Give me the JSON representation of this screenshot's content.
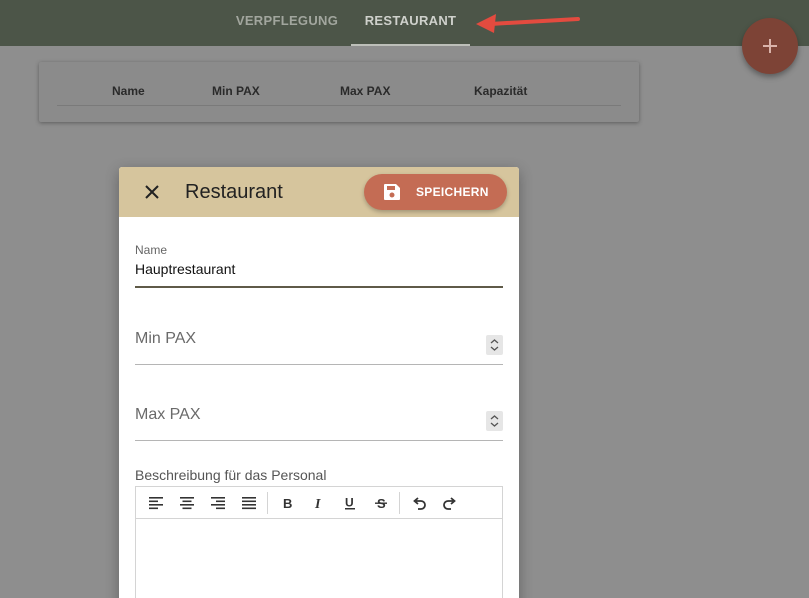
{
  "tabs": [
    {
      "label": "VERPFLEGUNG"
    },
    {
      "label": "RESTAURANT",
      "active": true
    }
  ],
  "table": {
    "headers": [
      "Name",
      "Min PAX",
      "Max PAX",
      "Kapazität"
    ]
  },
  "dialog": {
    "title": "Restaurant",
    "save_label": "SPEICHERN",
    "fields": {
      "name": {
        "label": "Name",
        "value": "Hauptrestaurant"
      },
      "min_pax": {
        "placeholder": "Min PAX"
      },
      "max_pax": {
        "placeholder": "Max PAX"
      }
    },
    "description_label": "Beschreibung für das Personal",
    "editor_tools": [
      "align-left-icon",
      "align-center-icon",
      "align-right-icon",
      "align-justify-icon",
      "bold-icon",
      "italic-icon",
      "underline-icon",
      "strikethrough-icon",
      "undo-icon",
      "redo-icon"
    ]
  },
  "colors": {
    "topbar": "#4c5548",
    "dialog_header": "#d6c59d",
    "save_button": "#c46c54",
    "fab": "#7d4336",
    "annotation_arrow": "#e34b3f"
  }
}
